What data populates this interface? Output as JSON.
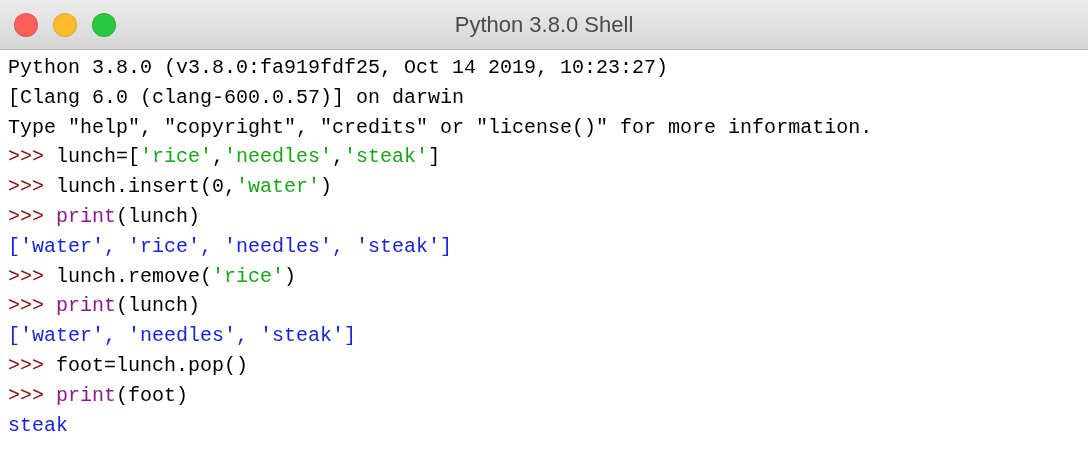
{
  "window": {
    "title": "Python 3.8.0 Shell"
  },
  "lines": [
    [
      {
        "kind": "plain",
        "text": "Python 3.8.0 (v3.8.0:fa919fdf25, Oct 14 2019, 10:23:27)"
      }
    ],
    [
      {
        "kind": "plain",
        "text": "[Clang 6.0 (clang-600.0.57)] on darwin"
      }
    ],
    [
      {
        "kind": "plain",
        "text": "Type \"help\", \"copyright\", \"credits\" or \"license()\" for more information."
      }
    ],
    [
      {
        "kind": "prompt",
        "text": ">>> "
      },
      {
        "kind": "code",
        "text": "lunch=["
      },
      {
        "kind": "string",
        "text": "'rice'"
      },
      {
        "kind": "code",
        "text": ","
      },
      {
        "kind": "string",
        "text": "'needles'"
      },
      {
        "kind": "code",
        "text": ","
      },
      {
        "kind": "string",
        "text": "'steak'"
      },
      {
        "kind": "code",
        "text": "]"
      }
    ],
    [
      {
        "kind": "prompt",
        "text": ">>> "
      },
      {
        "kind": "code",
        "text": "lunch.insert(0,"
      },
      {
        "kind": "string",
        "text": "'water'"
      },
      {
        "kind": "code",
        "text": ")"
      }
    ],
    [
      {
        "kind": "prompt",
        "text": ">>> "
      },
      {
        "kind": "builtin",
        "text": "print"
      },
      {
        "kind": "code",
        "text": "(lunch)"
      }
    ],
    [
      {
        "kind": "output",
        "text": "['water', 'rice', 'needles', 'steak']"
      }
    ],
    [
      {
        "kind": "prompt",
        "text": ">>> "
      },
      {
        "kind": "code",
        "text": "lunch.remove("
      },
      {
        "kind": "string",
        "text": "'rice'"
      },
      {
        "kind": "code",
        "text": ")"
      }
    ],
    [
      {
        "kind": "prompt",
        "text": ">>> "
      },
      {
        "kind": "builtin",
        "text": "print"
      },
      {
        "kind": "code",
        "text": "(lunch)"
      }
    ],
    [
      {
        "kind": "output",
        "text": "['water', 'needles', 'steak']"
      }
    ],
    [
      {
        "kind": "prompt",
        "text": ">>> "
      },
      {
        "kind": "code",
        "text": "foot=lunch.pop()"
      }
    ],
    [
      {
        "kind": "prompt",
        "text": ">>> "
      },
      {
        "kind": "builtin",
        "text": "print"
      },
      {
        "kind": "code",
        "text": "(foot)"
      }
    ],
    [
      {
        "kind": "output",
        "text": "steak"
      }
    ]
  ]
}
